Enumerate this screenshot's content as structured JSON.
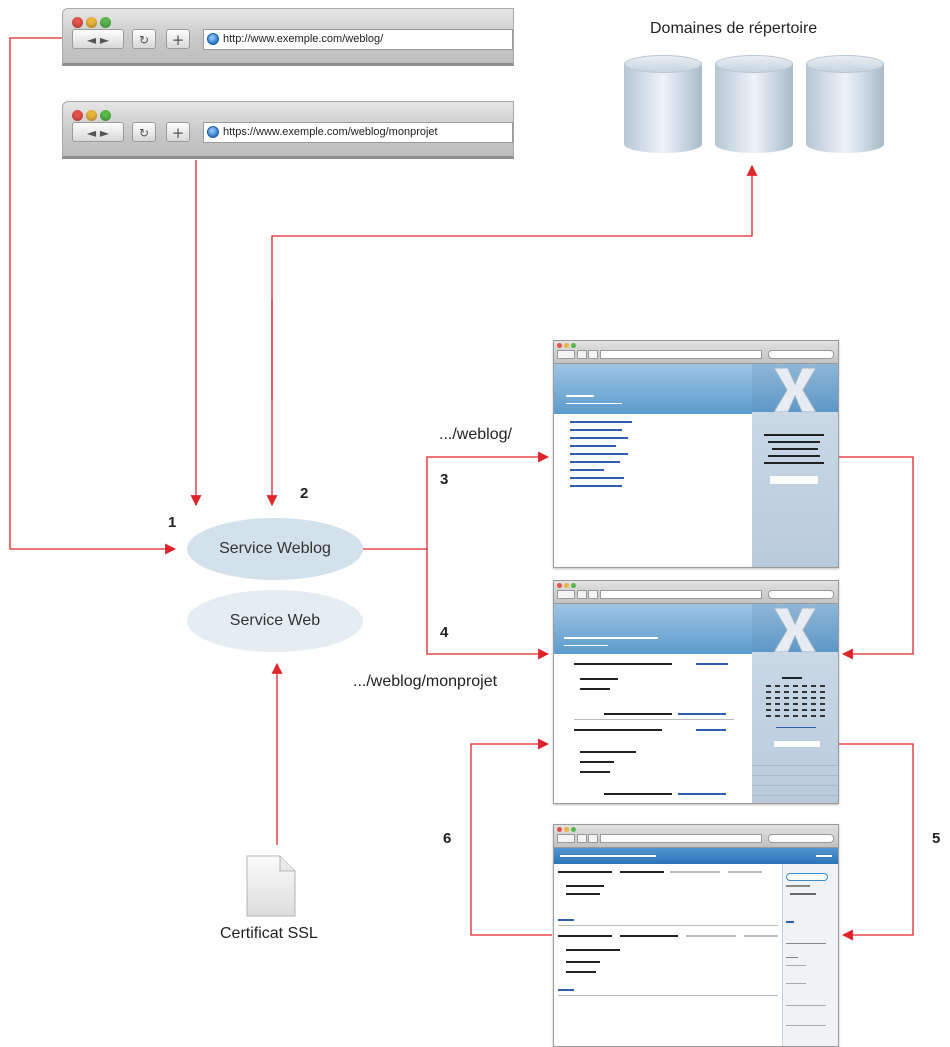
{
  "browsers": [
    {
      "url": "http://www.exemple.com/weblog/"
    },
    {
      "url": "https://www.exemple.com/weblog/monprojet"
    }
  ],
  "directory": {
    "title": "Domaines de répertoire"
  },
  "services": {
    "weblog": "Service Weblog",
    "web": "Service Web"
  },
  "certificate": {
    "label": "Certificat SSL"
  },
  "paths": {
    "weblog": ".../weblog/",
    "monprojet": ".../weblog/monprojet"
  },
  "steps": [
    "1",
    "2",
    "3",
    "4",
    "5",
    "6"
  ],
  "colors": {
    "arrow": "#e0242b",
    "ellipse": "#d3e1ea",
    "ellipse_light": "#e3edf2"
  }
}
